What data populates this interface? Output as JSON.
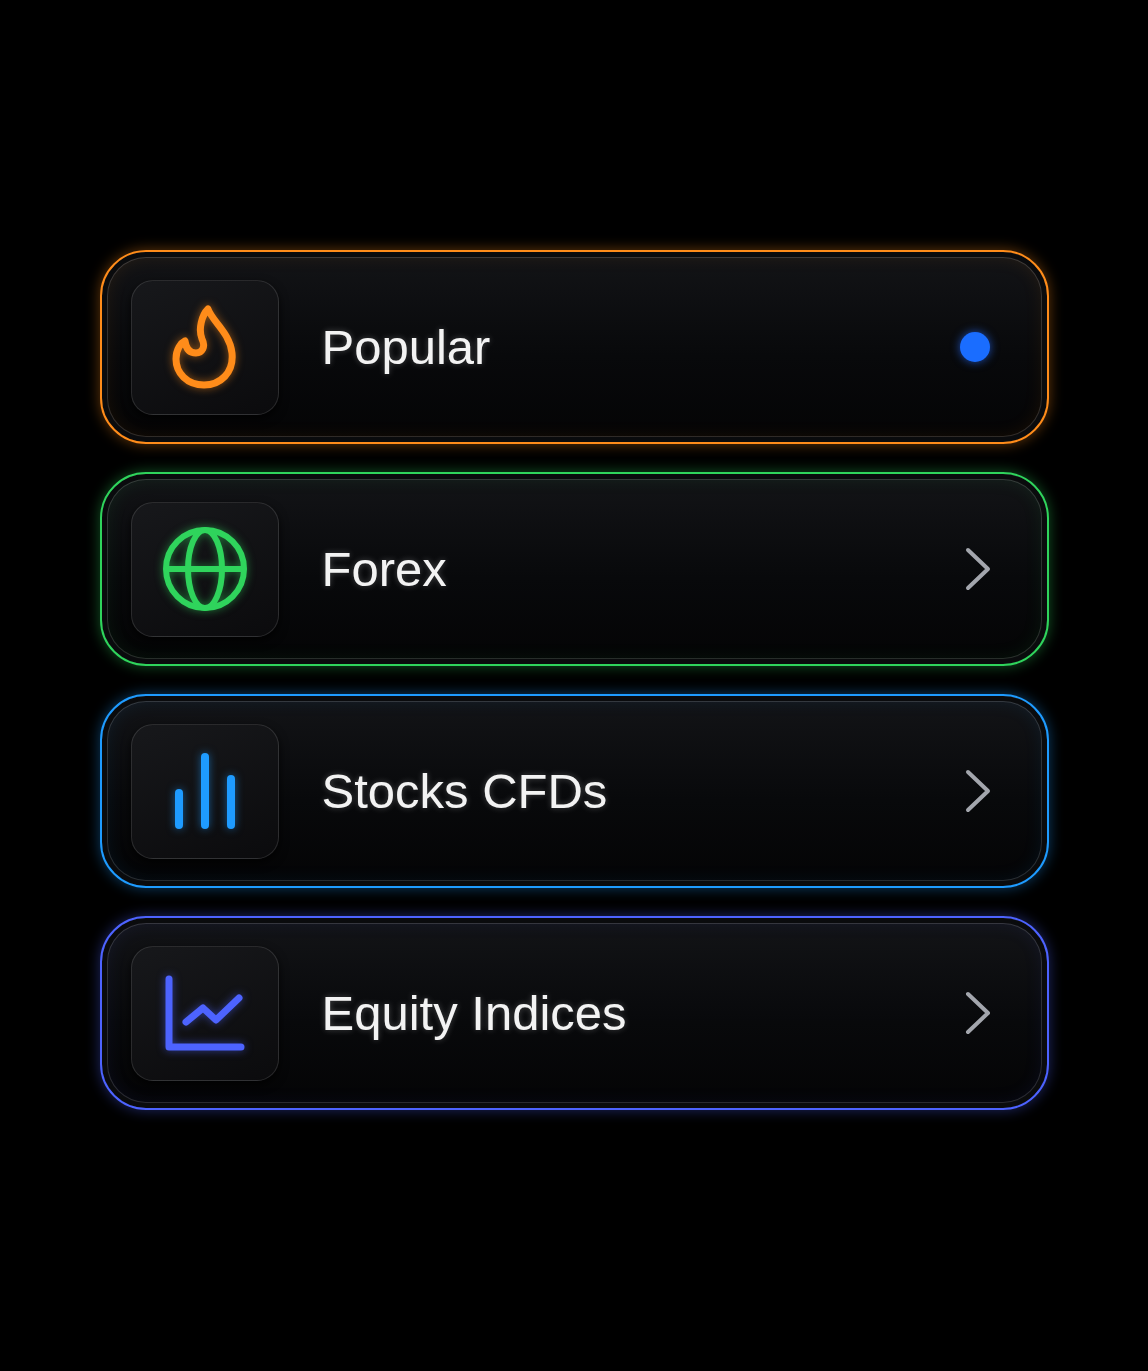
{
  "items": [
    {
      "label": "Popular",
      "color": "#ff8c1a",
      "selected": true
    },
    {
      "label": "Forex",
      "color": "#2fd45c",
      "selected": false
    },
    {
      "label": "Stocks CFDs",
      "color": "#1e9bff",
      "selected": false
    },
    {
      "label": "Equity Indices",
      "color": "#4d63ff",
      "selected": false
    }
  ]
}
